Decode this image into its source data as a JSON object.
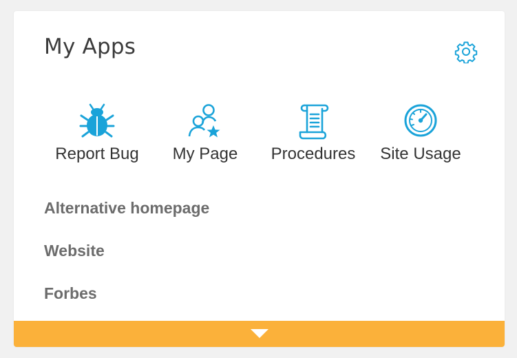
{
  "widget": {
    "title": "My Apps",
    "settings_icon": "gear-icon"
  },
  "apps": [
    {
      "label": "Report Bug",
      "icon": "bug-icon"
    },
    {
      "label": "My Page",
      "icon": "users-star-icon"
    },
    {
      "label": "Procedures",
      "icon": "scroll-icon"
    },
    {
      "label": "Site Usage",
      "icon": "gauge-icon"
    }
  ],
  "links": [
    {
      "label": "Alternative homepage"
    },
    {
      "label": "Website"
    },
    {
      "label": "Forbes"
    }
  ],
  "footer": {
    "expand_icon": "chevron-down-icon"
  },
  "colors": {
    "accent": "#1aa3d9",
    "footer_bar": "#fbb13a",
    "title_text": "#3b3b3b",
    "link_text": "#6c6c6c",
    "background": "#f1f1f1"
  }
}
